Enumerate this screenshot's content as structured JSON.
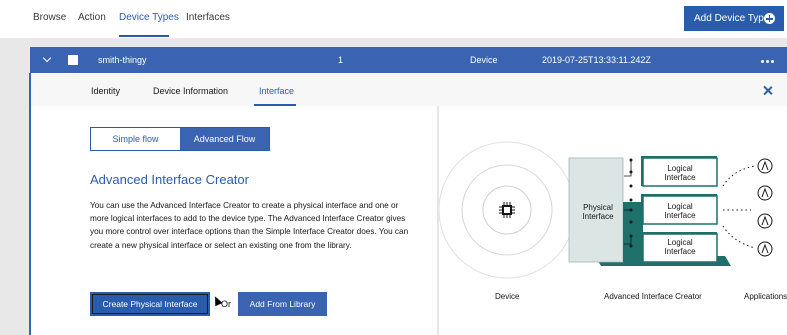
{
  "nav": {
    "tabs": [
      {
        "label": "Browse"
      },
      {
        "label": "Action"
      },
      {
        "label": "Device Types"
      },
      {
        "label": "Interfaces"
      }
    ],
    "add_button": "Add Device Type"
  },
  "row": {
    "name": "smith-thingy",
    "count": "1",
    "class": "Device",
    "timestamp": "2019-07-25T13:33:11.242Z"
  },
  "subtabs": [
    {
      "label": "Identity"
    },
    {
      "label": "Device Information"
    },
    {
      "label": "Interface"
    }
  ],
  "panel": {
    "toggle": {
      "simple": "Simple flow",
      "advanced": "Advanced Flow"
    },
    "heading": "Advanced Interface Creator",
    "description": "You can use the Advanced Interface Creator to create a physical interface and one or more logical interfaces to add to the device type. The Advanced Interface Creator gives you more control over interface options than the Simple Interface Creator does. You can create a new physical interface or select an existing one from the library.",
    "create_button": "Create Physical Interface",
    "or_text": "Or",
    "library_button": "Add From Library"
  },
  "diagram": {
    "physical": "Physical Interface",
    "logical": [
      "Logical Interface",
      "Logical Interface",
      "Logical Interface"
    ],
    "labels": {
      "device": "Device",
      "creator": "Advanced Interface Creator",
      "applications": "Applications"
    }
  },
  "colors": {
    "accent": "#2a5cae",
    "row": "#3a64b1",
    "teal": "#1f6f6a"
  }
}
